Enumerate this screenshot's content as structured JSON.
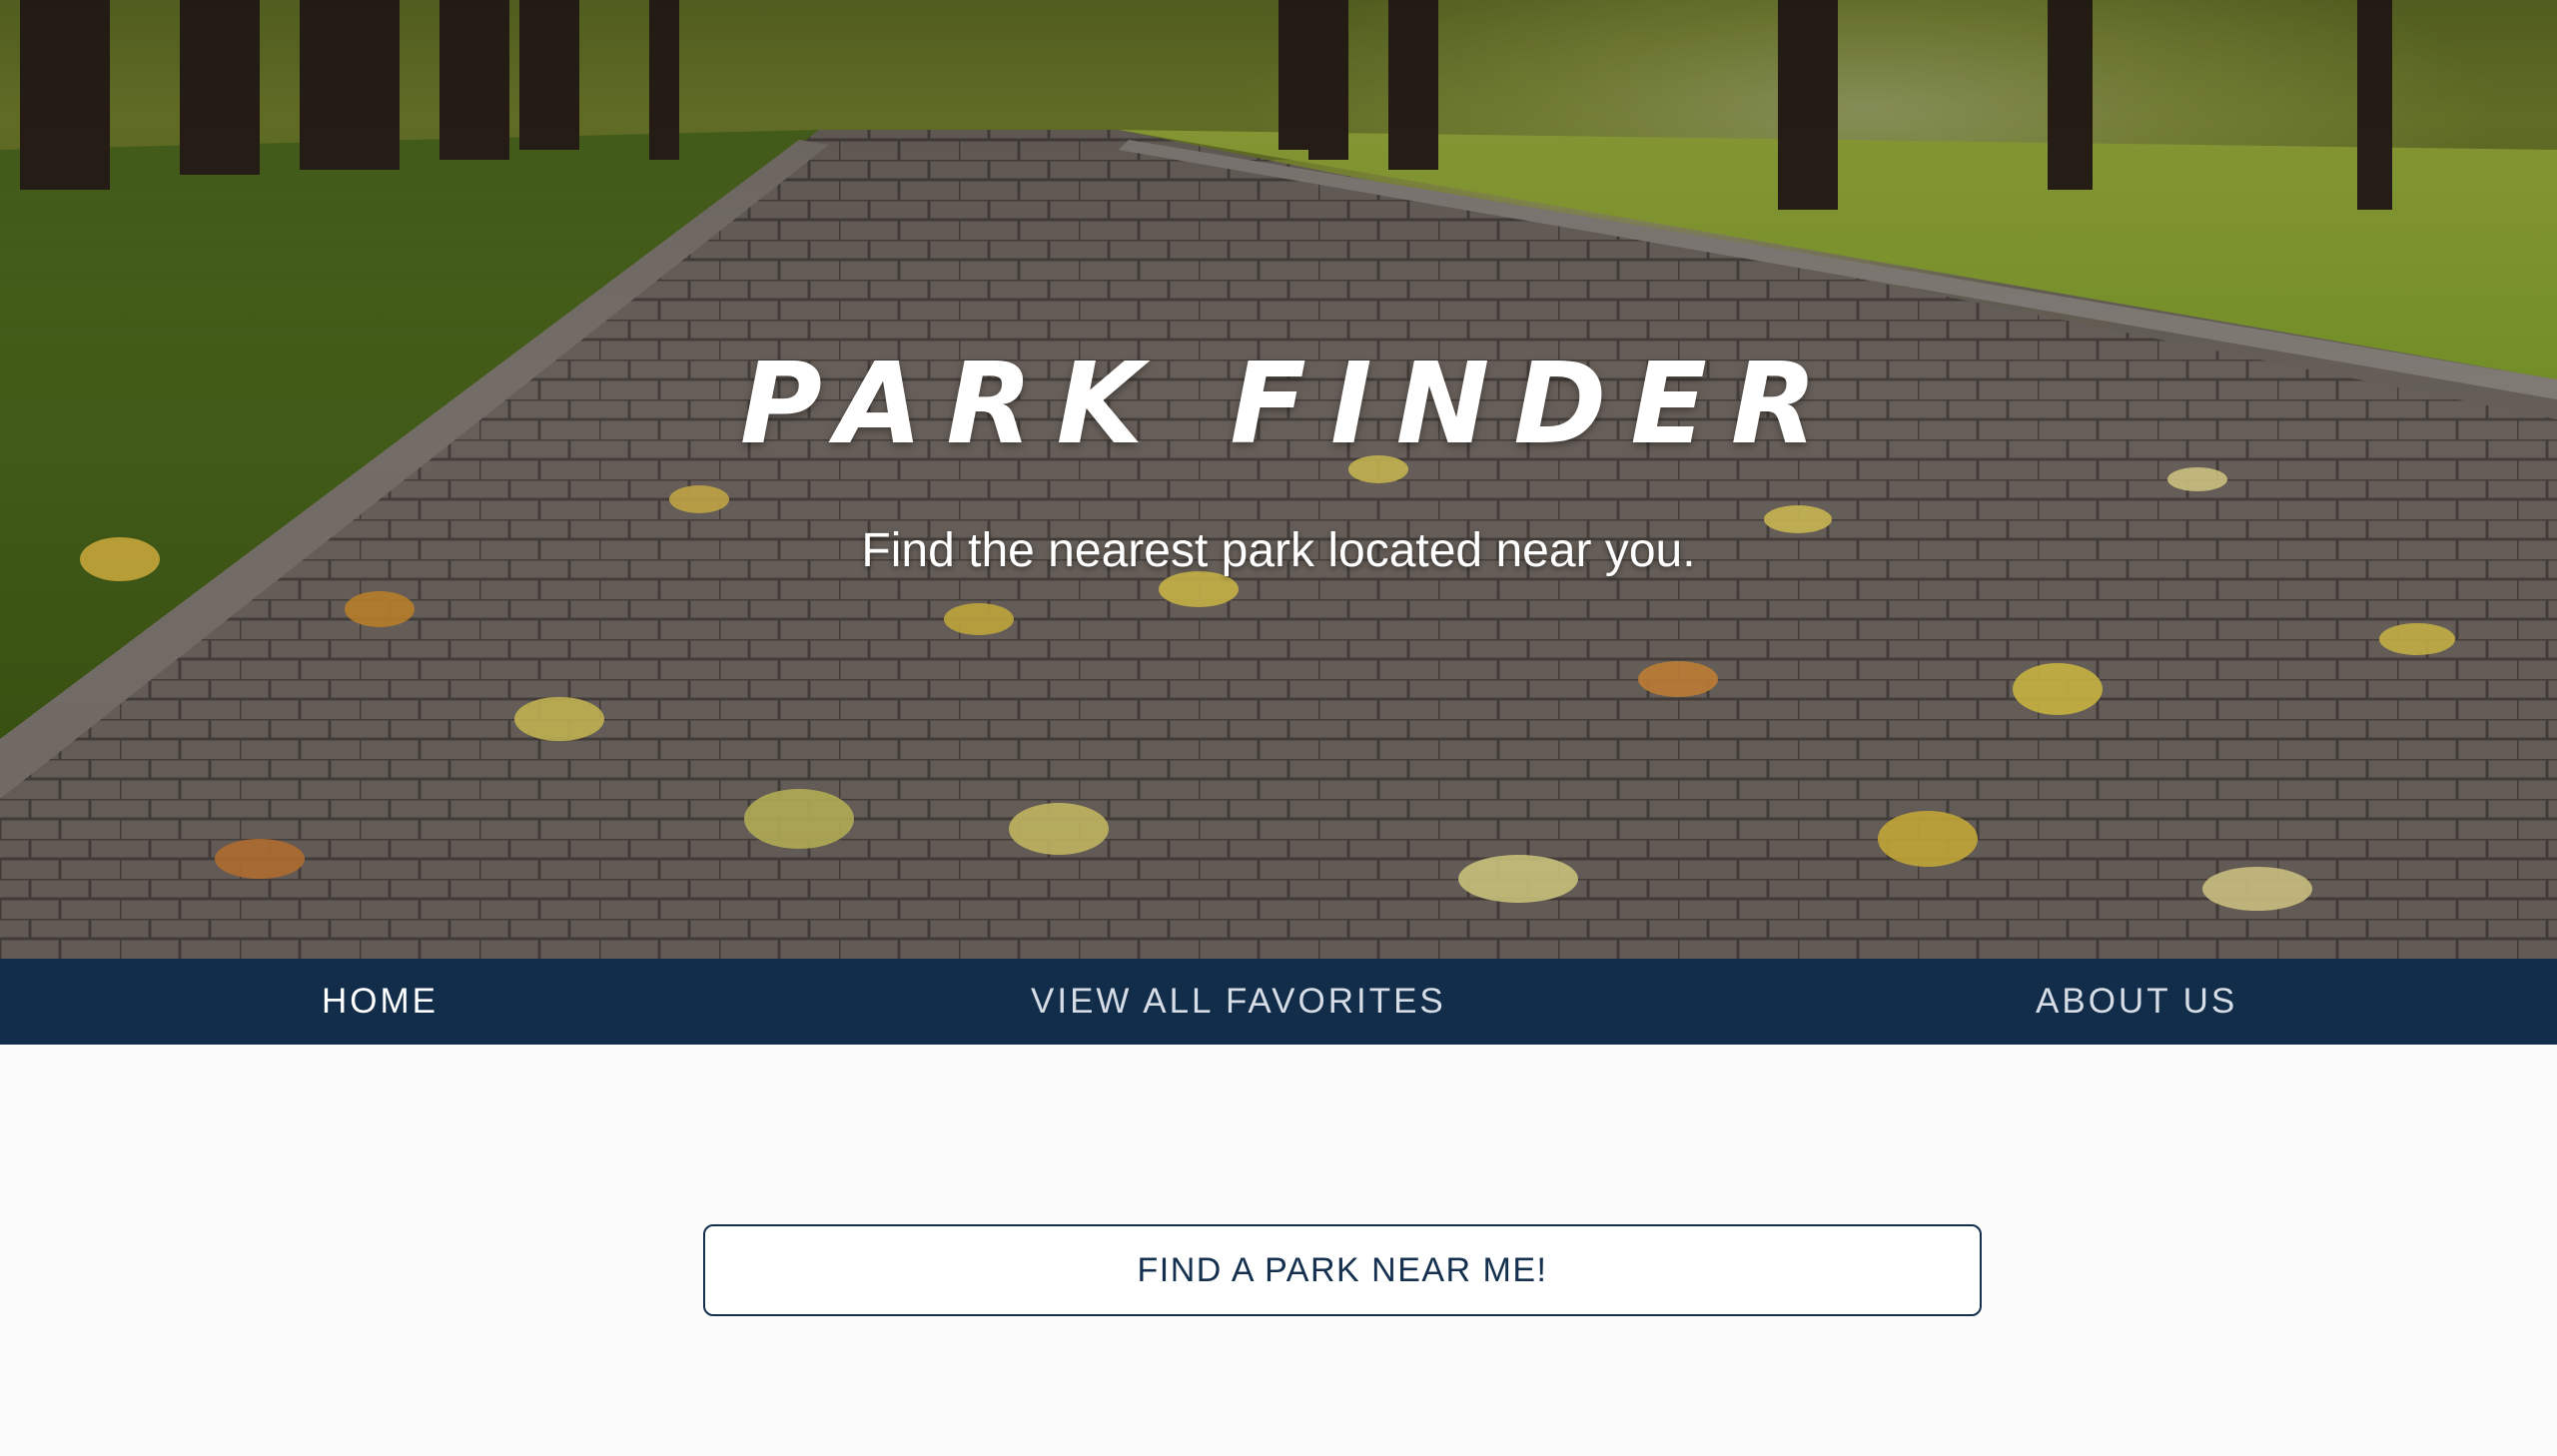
{
  "hero": {
    "title": "PARK FINDER",
    "subtitle": "Find the nearest park located near you."
  },
  "nav": {
    "items": [
      {
        "label": "HOME",
        "active": true
      },
      {
        "label": "VIEW ALL FAVORITES",
        "active": false
      },
      {
        "label": "ABOUT US",
        "active": false
      }
    ]
  },
  "main": {
    "find_button_label": "FIND A PARK NEAR ME!"
  },
  "colors": {
    "nav_background": "#112d4a",
    "button_border": "#14304e",
    "page_background": "#fbfbfb"
  }
}
